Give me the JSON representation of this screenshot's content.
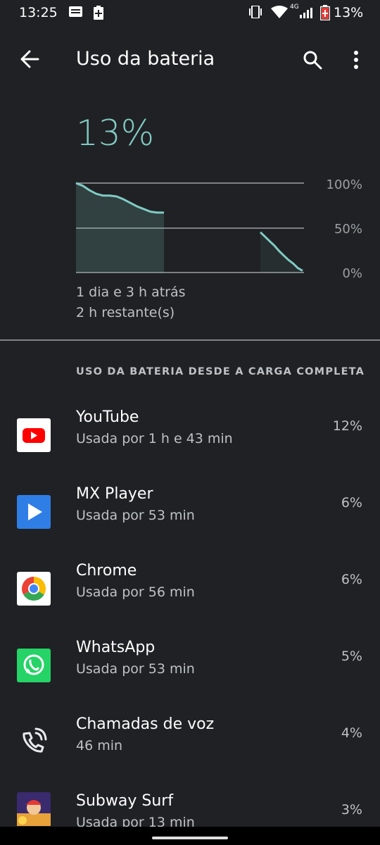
{
  "status_bar": {
    "time": "13:25",
    "network": "4G",
    "battery": "13%",
    "icons": [
      "message-icon",
      "battery-saver-icon",
      "vibrate-icon",
      "wifi-icon",
      "signal-icon",
      "battery-icon"
    ]
  },
  "app_bar": {
    "title": "Uso da bateria",
    "icons": [
      "back-arrow-icon",
      "search-icon",
      "more-vert-icon"
    ]
  },
  "battery": {
    "level": "13%",
    "level_value": 13,
    "since": "1 dia e 3 h atrás",
    "remaining": "2 h restante(s)"
  },
  "chart_data": {
    "type": "line",
    "y_tick_labels": [
      "100%",
      "50%",
      "0%"
    ],
    "ylim": [
      0,
      100
    ],
    "grid": true,
    "series": [
      {
        "segment": "history",
        "y": [
          100,
          97,
          92,
          88,
          86,
          86,
          85,
          82,
          78,
          74,
          71,
          68,
          67,
          67
        ]
      },
      {
        "segment": "projection",
        "y": [
          45,
          40,
          35,
          30,
          24,
          19,
          14,
          10,
          5,
          2
        ]
      }
    ],
    "accent": "#80cbc4"
  },
  "section_header": "USO DA BATERIA DESDE A CARGA COMPLETA",
  "apps": [
    {
      "name": "YouTube",
      "usage": "Usada por 1 h e 43 min",
      "percent": "12%",
      "icon": "youtube-icon"
    },
    {
      "name": "MX Player",
      "usage": "Usada por 53 min",
      "percent": "6%",
      "icon": "mx-player-icon"
    },
    {
      "name": "Chrome",
      "usage": "Usada por 56 min",
      "percent": "6%",
      "icon": "chrome-icon"
    },
    {
      "name": "WhatsApp",
      "usage": "Usada por 53 min",
      "percent": "5%",
      "icon": "whatsapp-icon"
    },
    {
      "name": "Chamadas de voz",
      "usage": "46 min",
      "percent": "4%",
      "icon": "voice-call-icon"
    },
    {
      "name": "Subway Surf",
      "usage": "Usada por 13 min",
      "percent": "3%",
      "icon": "subway-surf-icon"
    }
  ],
  "colors": {
    "background": "#202124",
    "accent": "#80cbc4",
    "youtube_red": "#ff0000",
    "mx_blue": "#2f7ee6",
    "whatsapp_green": "#25d366"
  }
}
